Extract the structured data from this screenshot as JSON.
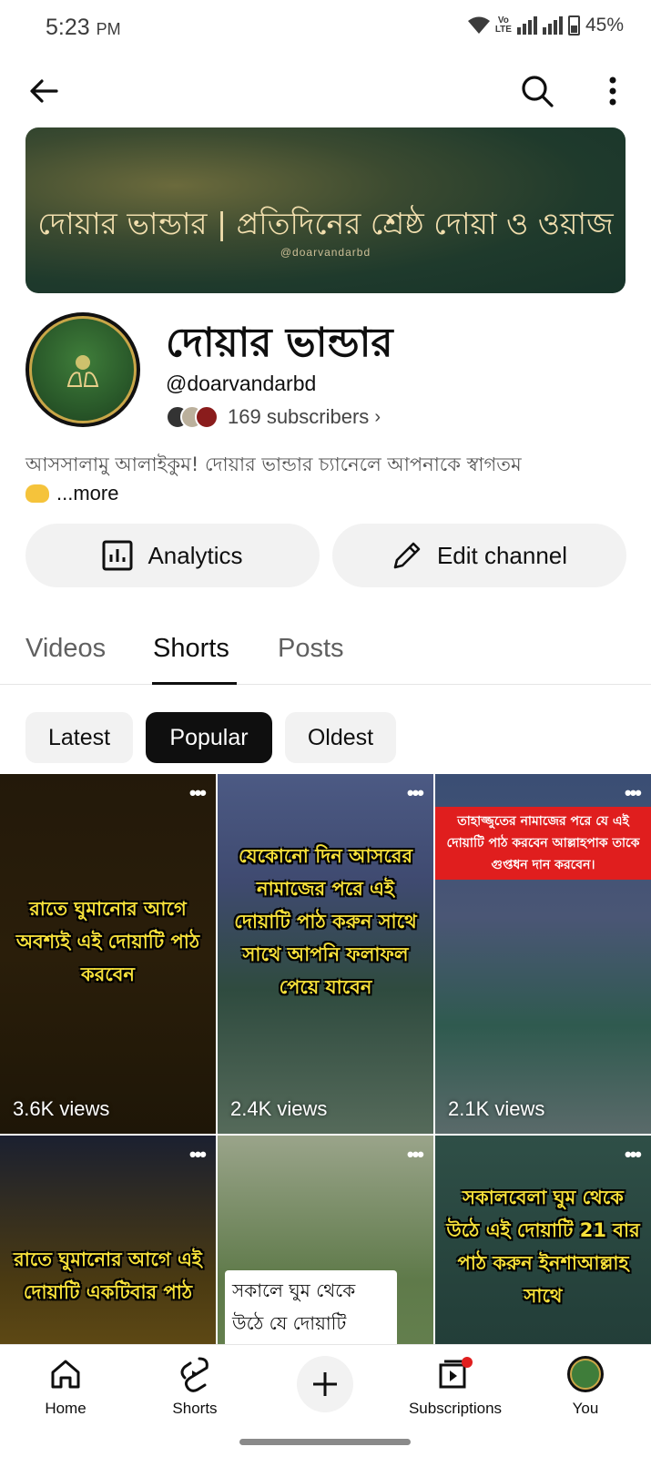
{
  "status_bar": {
    "time": "5:23",
    "ampm": "PM",
    "volte": "Vo LTE",
    "battery": "45%"
  },
  "topbar": {
    "back_icon": "arrow-left-icon",
    "search_icon": "search-icon",
    "more_icon": "more-vertical-icon"
  },
  "banner": {
    "title": "দোয়ার ভান্ডার | প্রতিদিনের শ্রেষ্ঠ দোয়া ও ওয়াজ",
    "handle": "@doarvandarbd",
    "colors": {
      "bg": "#1f3a2c",
      "text": "#f2dfae"
    }
  },
  "channel": {
    "name": "দোয়ার ভান্ডার",
    "handle": "@doarvandarbd",
    "subscribers": "169 subscribers",
    "about": "আসসালামু আলাইকুম! দোয়ার ভান্ডার চ্যানেলে আপনাকে স্বাগতম",
    "more": "...more"
  },
  "actions": {
    "analytics": "Analytics",
    "edit_channel": "Edit channel"
  },
  "tabs": [
    {
      "label": "Videos",
      "active": false
    },
    {
      "label": "Shorts",
      "active": true
    },
    {
      "label": "Posts",
      "active": false
    }
  ],
  "chips": [
    {
      "label": "Latest",
      "active": false
    },
    {
      "label": "Popular",
      "active": true
    },
    {
      "label": "Oldest",
      "active": false
    }
  ],
  "shorts": [
    {
      "text": "রাতে ঘুমানোর আগে অবশ্যই এই দোয়াটি পাঠ করবেন",
      "views": "3.6K views"
    },
    {
      "text": "যেকোনো দিন আসরের নামাজের পরে এই দোয়াটি পাঠ করুন সাথে সাথে আপনি ফলাফল পেয়ে যাবেন",
      "views": "2.4K views"
    },
    {
      "text": "তাহাজ্জুতের নামাজের পরে যে এই দোয়াটি পাঠ করবেন আল্লাহপাক তাকে গুপ্তধন দান করবেন।",
      "views": "2.1K views"
    },
    {
      "text": "রাতে ঘুমানোর আগে এই দোয়াটি একটিবার পাঠ",
      "views": ""
    },
    {
      "text": "সকালে ঘুম থেকে উঠে যে দোয়াটি অবশ্যই",
      "views": ""
    },
    {
      "text": "সকালবেলা ঘুম থেকে উঠে এই দোয়াটি 21 বার পাঠ করুন ইনশাআল্লাহ সাথে",
      "views": ""
    }
  ],
  "bottom_nav": {
    "home": "Home",
    "shorts": "Shorts",
    "subscriptions": "Subscriptions",
    "you": "You"
  },
  "colors": {
    "accent_red": "#e01e1e",
    "text_primary": "#0f0f0f",
    "chip_bg": "#f2f2f2"
  }
}
